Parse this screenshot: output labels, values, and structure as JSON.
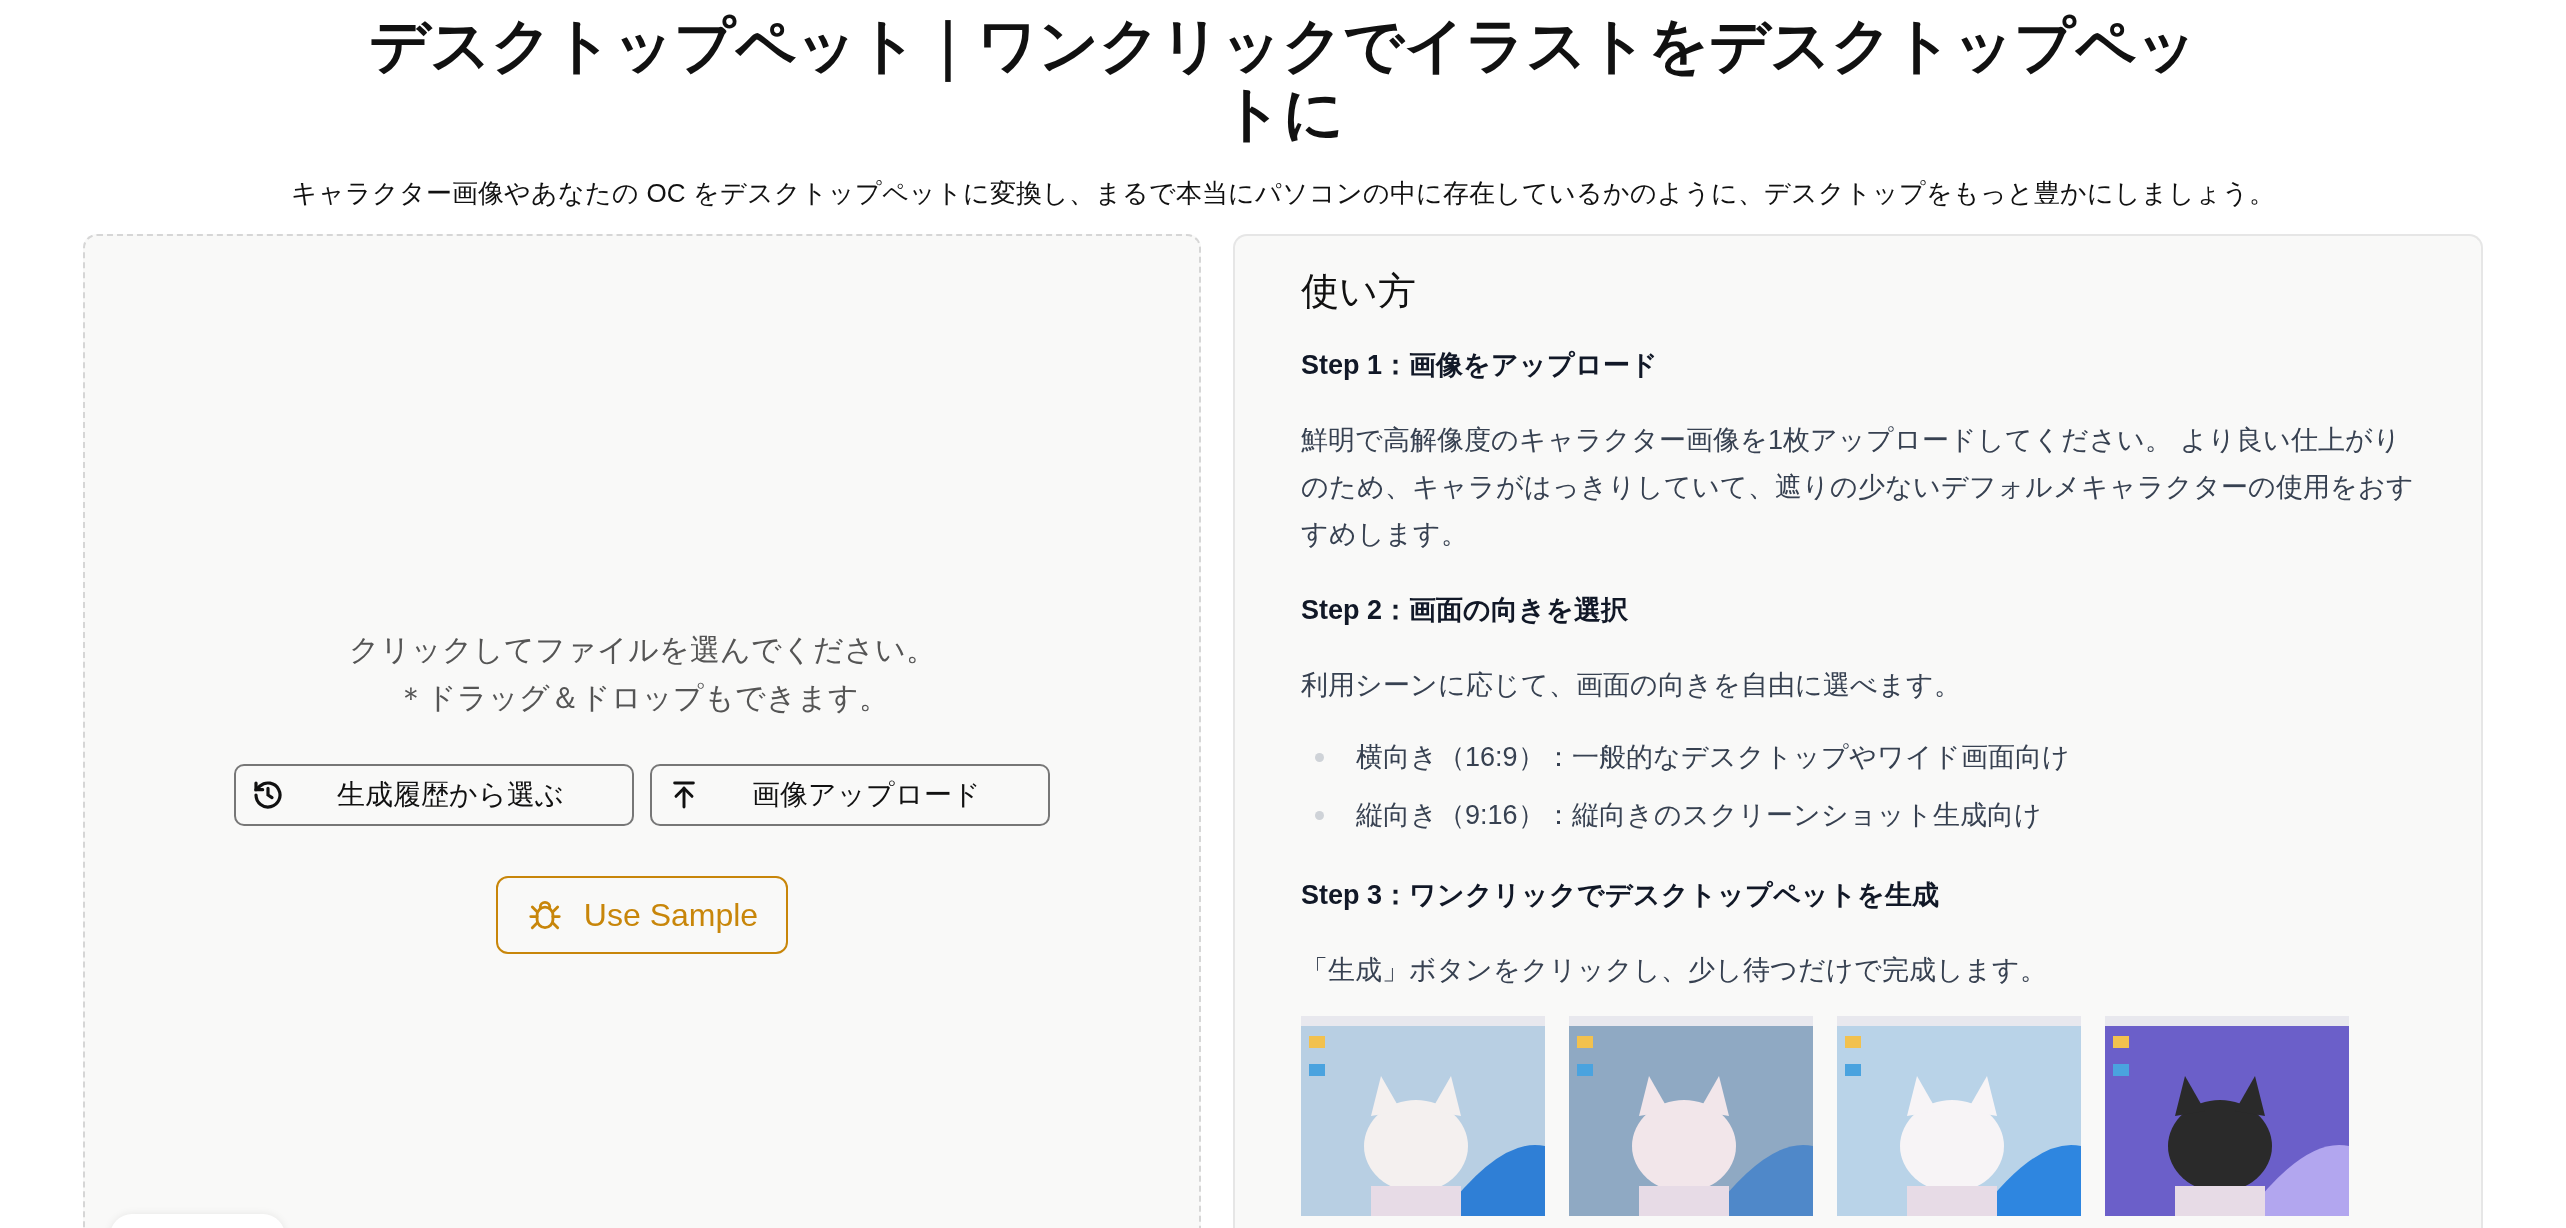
{
  "header": {
    "title": "デスクトップペット｜ワンクリックでイラストをデスクトップペットに",
    "subtitle": "キャラクター画像やあなたの OC をデスクトップペットに変換し、まるで本当にパソコンの中に存在しているかのように、デスクトップをもっと豊かにしましょう。"
  },
  "upload": {
    "prompt": "クリックしてファイルを選んでください。",
    "hint": "＊ドラッグ＆ドロップもできます。",
    "buttons": [
      {
        "kind": "history",
        "label": "生成履歴から選ぶ"
      },
      {
        "kind": "upload",
        "label": "画像アップロード"
      }
    ],
    "sample_button": "Use Sample"
  },
  "guide": {
    "title": "使い方",
    "sections": [
      {
        "kind": "heading",
        "text": "Step 1：画像をアップロード"
      },
      {
        "kind": "paragraph",
        "text": "鮮明で高解像度のキャラクター画像を1枚アップロードしてください。 より良い仕上がりのため、キャラがはっきりしていて、遮りの少ないデフォルメキャラクターの使用をおすすめします。"
      },
      {
        "kind": "heading",
        "text": "Step 2：画面の向きを選択"
      },
      {
        "kind": "paragraph",
        "text": "利用シーンに応じて、画面の向きを自由に選べます。"
      },
      {
        "kind": "bullets",
        "items": [
          "横向き（16:9）：一般的なデスクトップやワイド画面向け",
          "縦向き（9:16）：縦向きのスクリーンショット生成向け"
        ]
      },
      {
        "kind": "heading",
        "text": "Step 3：ワンクリックでデスクトップペットを生成"
      },
      {
        "kind": "paragraph",
        "text": "「生成」ボタンをクリックし、少し待つだけで完成します。"
      }
    ]
  }
}
